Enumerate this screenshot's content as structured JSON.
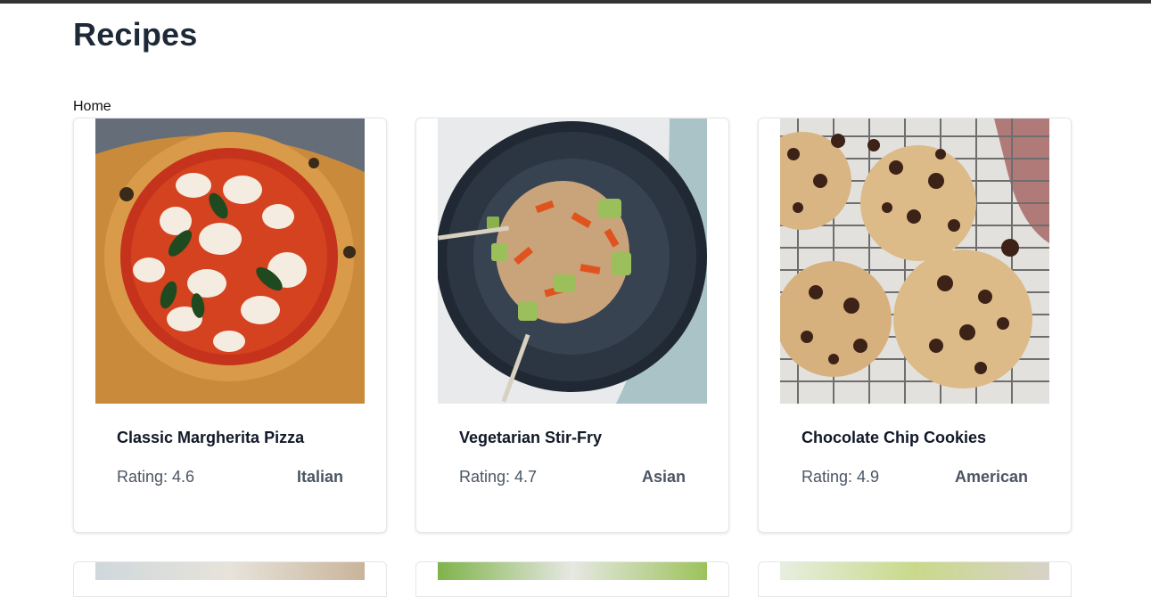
{
  "page": {
    "title": "Recipes"
  },
  "breadcrumb": {
    "home": "Home"
  },
  "recipes": [
    {
      "name": "Classic Margherita Pizza",
      "rating_label": "Rating: 4.6",
      "cuisine": "Italian"
    },
    {
      "name": "Vegetarian Stir-Fry",
      "rating_label": "Rating: 4.7",
      "cuisine": "Asian"
    },
    {
      "name": "Chocolate Chip Cookies",
      "rating_label": "Rating: 4.9",
      "cuisine": "American"
    }
  ],
  "colors": {
    "top_bar": "#333333",
    "title": "#1e2938",
    "card_border": "#e5e7eb",
    "meta_text": "#4b5563"
  }
}
